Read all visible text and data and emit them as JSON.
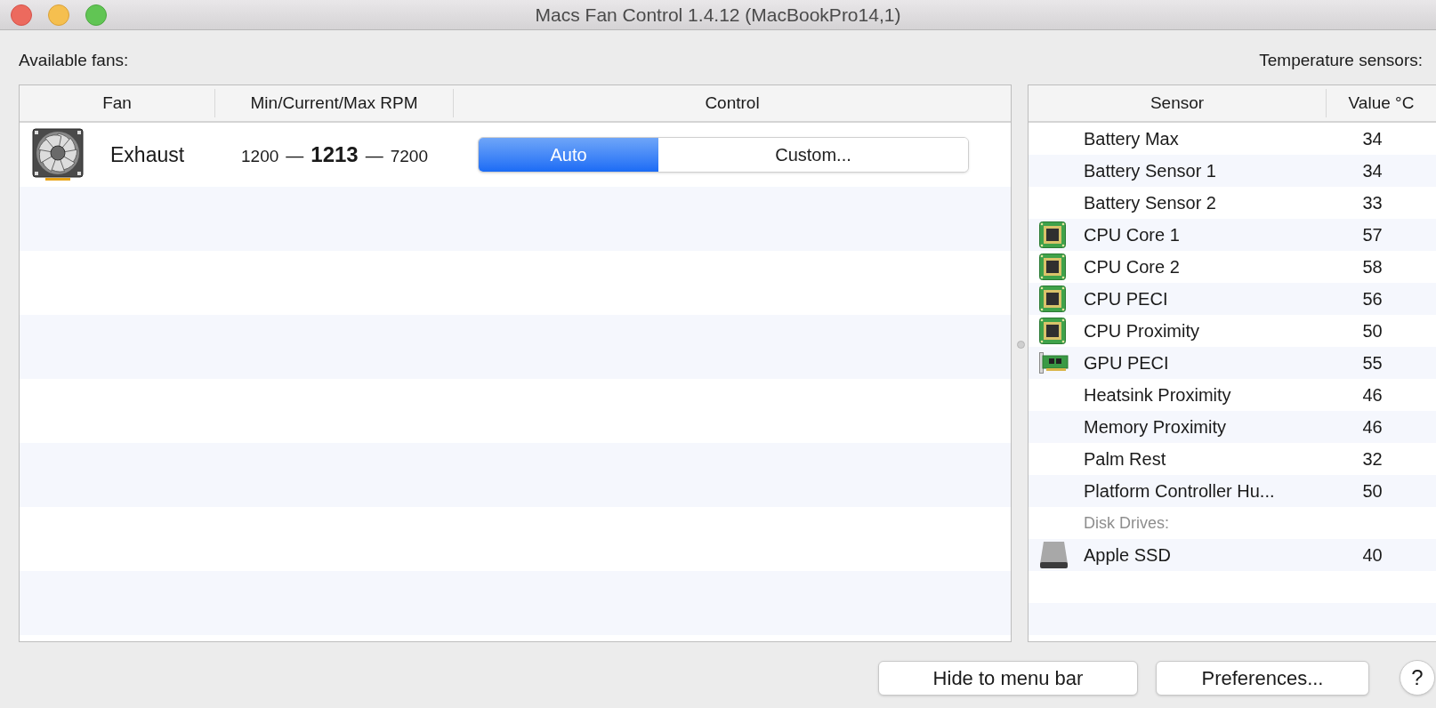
{
  "window": {
    "title": "Macs Fan Control 1.4.12 (MacBookPro14,1)"
  },
  "fans_panel": {
    "label": "Available fans:",
    "columns": [
      "Fan",
      "Min/Current/Max RPM",
      "Control"
    ],
    "rows": [
      {
        "name": "Exhaust",
        "rpm_min": "1200",
        "dash_1": "—",
        "rpm_current": "1213",
        "dash_2": "—",
        "rpm_max": "7200",
        "control": [
          {
            "label": "Auto",
            "selected": true
          },
          {
            "label": "Custom...",
            "selected": false
          }
        ]
      }
    ]
  },
  "sensors_panel": {
    "label": "Temperature sensors:",
    "columns": [
      "Sensor",
      "Value °C"
    ],
    "rows": [
      {
        "kind": "plain",
        "name": "Battery Max",
        "value": "34"
      },
      {
        "kind": "plain",
        "name": "Battery Sensor 1",
        "value": "34"
      },
      {
        "kind": "plain",
        "name": "Battery Sensor 2",
        "value": "33"
      },
      {
        "kind": "cpu",
        "name": "CPU Core 1",
        "value": "57"
      },
      {
        "kind": "cpu",
        "name": "CPU Core 2",
        "value": "58"
      },
      {
        "kind": "cpu",
        "name": "CPU PECI",
        "value": "56"
      },
      {
        "kind": "cpu",
        "name": "CPU Proximity",
        "value": "50"
      },
      {
        "kind": "gpu",
        "name": "GPU PECI",
        "value": "55"
      },
      {
        "kind": "plain",
        "name": "Heatsink Proximity",
        "value": "46"
      },
      {
        "kind": "plain",
        "name": "Memory Proximity",
        "value": "46"
      },
      {
        "kind": "plain",
        "name": "Palm Rest",
        "value": "32"
      },
      {
        "kind": "plain",
        "name": "Platform Controller Hu...",
        "value": "50"
      },
      {
        "kind": "group",
        "name": "Disk Drives:"
      },
      {
        "kind": "disk",
        "name": "Apple SSD",
        "value": "40"
      }
    ]
  },
  "buttons": [
    {
      "label": "Hide to menu bar"
    },
    {
      "label": "Preferences..."
    }
  ],
  "help_button": {
    "label": "?"
  }
}
